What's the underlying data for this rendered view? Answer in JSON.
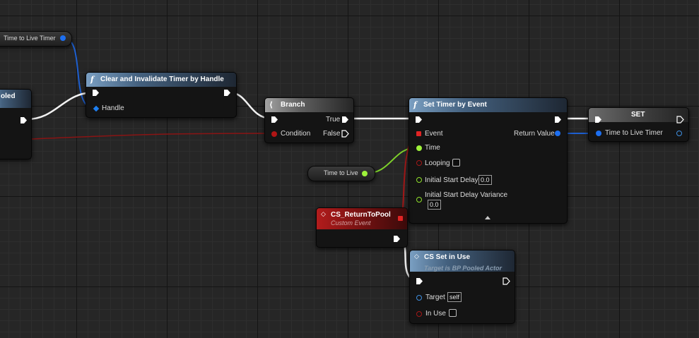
{
  "graph": {
    "get_time_to_live_timer": {
      "label": "Time to Live Timer"
    },
    "partial_node": {
      "title": "oled"
    },
    "clear_timer": {
      "title": "Clear and Invalidate Timer by Handle",
      "handle_label": "Handle"
    },
    "branch": {
      "title": "Branch",
      "true_label": "True",
      "condition_label": "Condition",
      "false_label": "False"
    },
    "set_timer": {
      "title": "Set Timer by Event",
      "event_label": "Event",
      "return_label": "Return Value",
      "time_label": "Time",
      "looping_label": "Looping",
      "initial_delay_label": "Initial Start Delay",
      "initial_delay_value": "0.0",
      "variance_label": "Initial Start Delay Variance",
      "variance_value": "0.0"
    },
    "set_node": {
      "title": "SET",
      "var_label": "Time to Live Timer"
    },
    "get_time_to_live": {
      "label": "Time to Live"
    },
    "custom_event": {
      "title": "CS_ReturnToPool",
      "subtitle": "Custom Event"
    },
    "cs_set_in_use": {
      "title": "CS Set in Use",
      "subtitle": "Target is BP Pooled Actor",
      "target_label": "Target",
      "target_value": "self",
      "in_use_label": "In Use"
    }
  },
  "colors": {
    "background": "#262626",
    "exec_wire": "#ffffff",
    "handle_wire": "#1d6ff0",
    "bool_wire": "#9a1515",
    "float_wire": "#9ef23a",
    "function_header": "#44617f",
    "event_header": "#b21c1c"
  },
  "icons": {
    "function": "function-icon",
    "branch": "branch-icon",
    "set": "set-icon",
    "collapse": "collapse-arrow-icon"
  }
}
